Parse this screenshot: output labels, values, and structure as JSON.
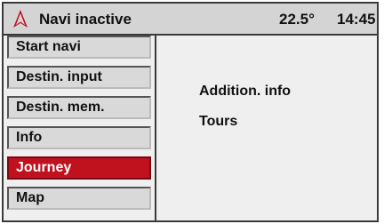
{
  "header": {
    "status_text": "Navi inactive",
    "temperature": "22.5°",
    "time": "14:45",
    "icon": "navigation-arrow-icon",
    "accent_color": "#c0111f"
  },
  "menu": {
    "items": [
      {
        "label": "Start navi"
      },
      {
        "label": "Destin. input"
      },
      {
        "label": "Destin. mem."
      },
      {
        "label": "Info"
      },
      {
        "label": "Journey",
        "selected": true
      },
      {
        "label": "Map"
      }
    ]
  },
  "content": {
    "items": [
      {
        "label": "Addition. info"
      },
      {
        "label": "Tours"
      }
    ]
  }
}
